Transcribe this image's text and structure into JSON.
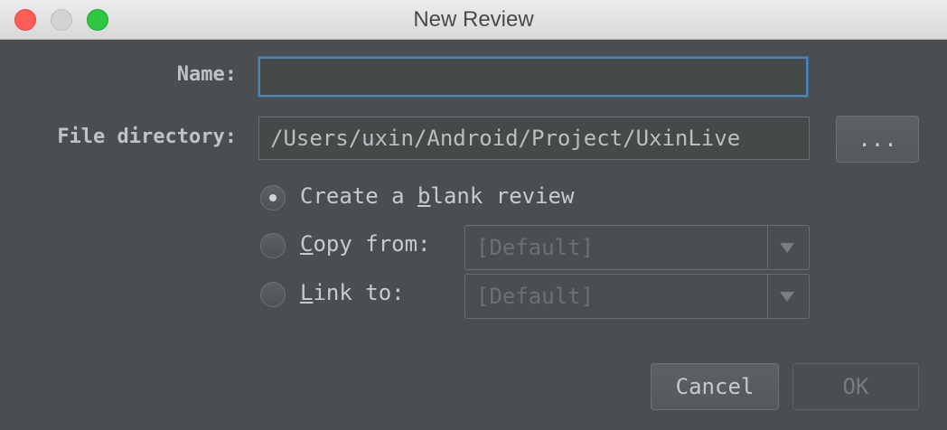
{
  "window": {
    "title": "New Review"
  },
  "form": {
    "name_label": "Name:",
    "name_value": "",
    "dir_label": "File directory:",
    "dir_value": "/Users/uxin/Android/Project/UxinLive",
    "browse_label": "...",
    "options": [
      {
        "pre": "Create a ",
        "mnemonic": "b",
        "post": "lank review",
        "selected": true
      },
      {
        "pre": "",
        "mnemonic": "C",
        "post": "opy from:",
        "selected": false,
        "combo_value": "[Default]"
      },
      {
        "pre": "",
        "mnemonic": "L",
        "post": "ink to:",
        "selected": false,
        "combo_value": "[Default]"
      }
    ]
  },
  "buttons": {
    "cancel": "Cancel",
    "ok": "OK"
  }
}
